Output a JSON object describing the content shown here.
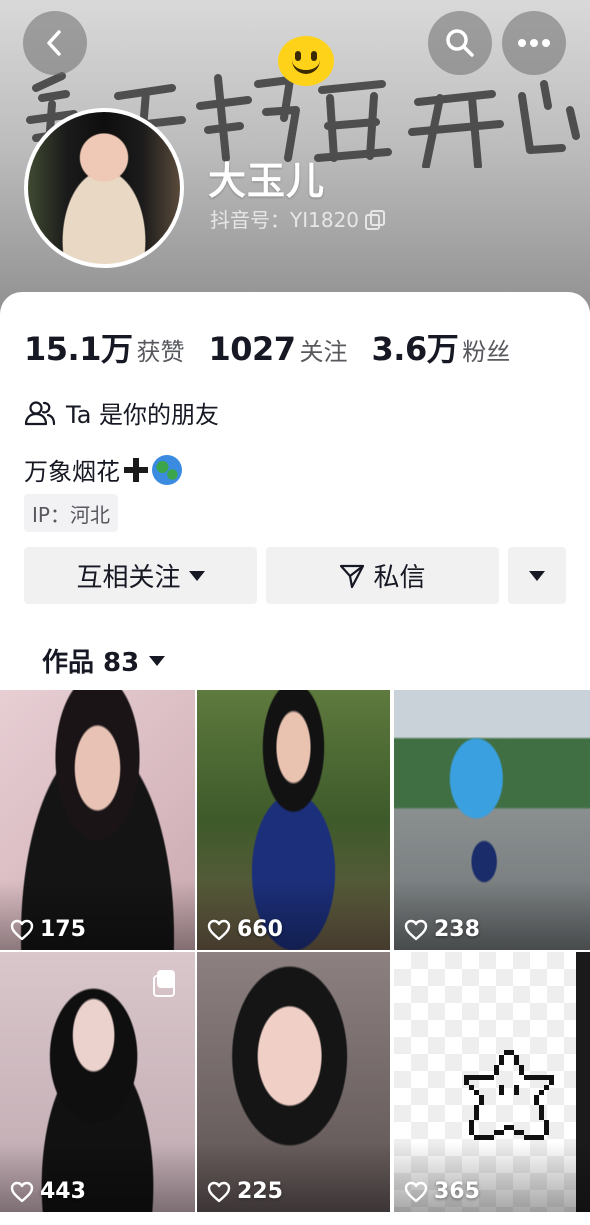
{
  "header": {
    "nickname": "大玉儿",
    "douyin_id": "抖音号：YI1820",
    "icons": [
      "back-icon",
      "search-icon",
      "more-icon",
      "copy-icon"
    ],
    "banner_text": "每天都要开心"
  },
  "stats": [
    {
      "value": "15.1万",
      "label": "获赞"
    },
    {
      "value": "1027",
      "label": "关注"
    },
    {
      "value": "3.6万",
      "label": "粉丝"
    }
  ],
  "friend_text": "Ta 是你的朋友",
  "bio": "万象烟花",
  "ip": "IP：河北",
  "actions": {
    "follow_label": "互相关注",
    "message_label": "私信"
  },
  "works_tab": "作品 83",
  "videos": [
    {
      "likes": "175"
    },
    {
      "likes": "660"
    },
    {
      "likes": "238"
    },
    {
      "likes": "443",
      "multi": true
    },
    {
      "likes": "225"
    },
    {
      "likes": "365"
    }
  ],
  "colors": {
    "text_primary": "#161823",
    "text_secondary": "#57585e",
    "button_bg": "#f1f1f2"
  }
}
